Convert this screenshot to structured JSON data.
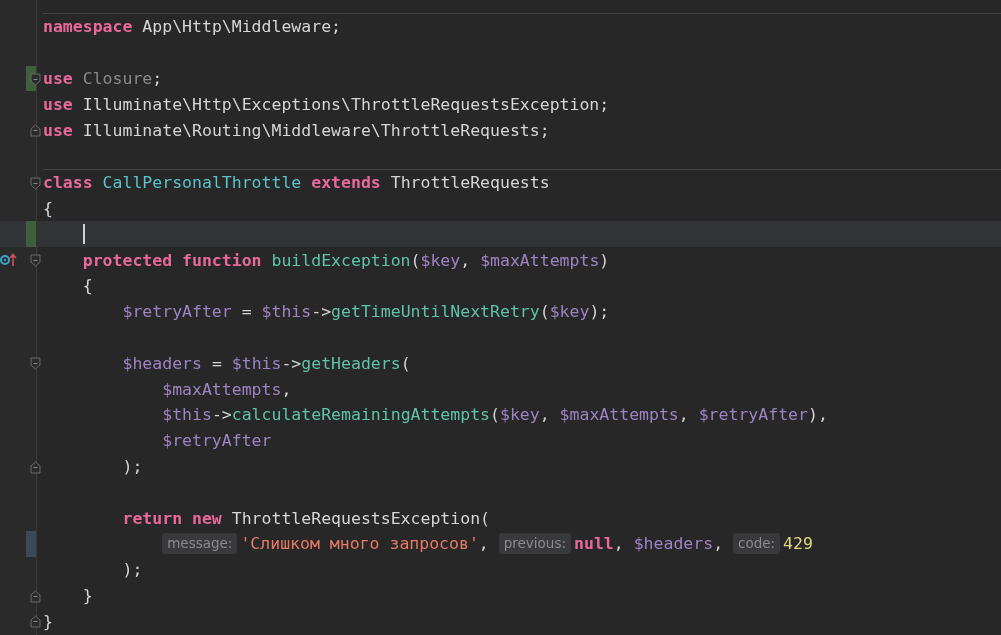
{
  "lines": [
    {
      "kind": "code",
      "separator_above": true,
      "tokens": [
        {
          "kind": "keyword",
          "text": "namespace"
        },
        {
          "kind": "plain",
          "text": " App\\Http\\Middleware;"
        }
      ]
    },
    {
      "kind": "blank"
    },
    {
      "kind": "code",
      "color": "#3f5e3c",
      "fold_start": true,
      "tokens": [
        {
          "kind": "keyword",
          "text": "use"
        },
        {
          "kind": "unused",
          "text": " Closure"
        },
        {
          "kind": "plain",
          "text": ";"
        }
      ]
    },
    {
      "kind": "code",
      "tokens": [
        {
          "kind": "keyword",
          "text": "use"
        },
        {
          "kind": "plain",
          "text": " Illuminate\\Http\\Exceptions\\ThrottleRequestsException;"
        }
      ]
    },
    {
      "kind": "code",
      "fold_end": true,
      "tokens": [
        {
          "kind": "keyword",
          "text": "use"
        },
        {
          "kind": "plain",
          "text": " Illuminate\\Routing\\Middleware\\ThrottleRequests;"
        }
      ]
    },
    {
      "kind": "blank"
    },
    {
      "kind": "code",
      "separator_above": true,
      "fold_start": true,
      "tokens": [
        {
          "kind": "keyword",
          "text": "class"
        },
        {
          "kind": "class",
          "text": " CallPersonalThrottle"
        },
        {
          "kind": "keyword",
          "text": " extends"
        },
        {
          "kind": "plain",
          "text": " ThrottleRequests"
        }
      ]
    },
    {
      "kind": "code",
      "tokens": [
        {
          "kind": "plain",
          "text": "{"
        }
      ],
      "children": [
        {
          "kind": "blank",
          "current": true,
          "color": "#3f5e3c"
        },
        {
          "kind": "code",
          "overridden": true,
          "fold_start": true,
          "tokens": [
            {
              "kind": "keyword",
              "text": "protected function"
            },
            {
              "kind": "method",
              "text": " buildException"
            },
            {
              "kind": "plain",
              "text": "("
            },
            {
              "kind": "variable",
              "text": "$key"
            },
            {
              "kind": "plain",
              "text": ", "
            },
            {
              "kind": "variable",
              "text": "$maxAttempts"
            },
            {
              "kind": "plain",
              "text": ")"
            }
          ]
        },
        {
          "kind": "code",
          "tokens": [
            {
              "kind": "plain",
              "text": "{"
            }
          ],
          "children": [
            {
              "kind": "code",
              "tokens": [
                {
                  "kind": "variable",
                  "text": "$retryAfter"
                },
                {
                  "kind": "plain",
                  "text": " = "
                },
                {
                  "kind": "variable",
                  "text": "$this"
                },
                {
                  "kind": "plain",
                  "text": "->"
                },
                {
                  "kind": "method",
                  "text": "getTimeUntilNextRetry"
                },
                {
                  "kind": "plain",
                  "text": "("
                },
                {
                  "kind": "variable",
                  "text": "$key"
                },
                {
                  "kind": "plain",
                  "text": ");"
                }
              ]
            },
            {
              "kind": "blank"
            },
            {
              "kind": "code",
              "fold_start": true,
              "tokens": [
                {
                  "kind": "variable",
                  "text": "$headers"
                },
                {
                  "kind": "plain",
                  "text": " = "
                },
                {
                  "kind": "variable",
                  "text": "$this"
                },
                {
                  "kind": "plain",
                  "text": "->"
                },
                {
                  "kind": "method",
                  "text": "getHeaders"
                },
                {
                  "kind": "plain",
                  "text": "("
                }
              ],
              "children": [
                {
                  "kind": "code",
                  "tokens": [
                    {
                      "kind": "variable",
                      "text": "$maxAttempts"
                    },
                    {
                      "kind": "plain",
                      "text": ","
                    }
                  ]
                },
                {
                  "kind": "code",
                  "tokens": [
                    {
                      "kind": "variable",
                      "text": "$this"
                    },
                    {
                      "kind": "plain",
                      "text": "->"
                    },
                    {
                      "kind": "method",
                      "text": "calculateRemainingAttempts"
                    },
                    {
                      "kind": "plain",
                      "text": "("
                    },
                    {
                      "kind": "variable",
                      "text": "$key"
                    },
                    {
                      "kind": "plain",
                      "text": ", "
                    },
                    {
                      "kind": "variable",
                      "text": "$maxAttempts"
                    },
                    {
                      "kind": "plain",
                      "text": ", "
                    },
                    {
                      "kind": "variable",
                      "text": "$retryAfter"
                    },
                    {
                      "kind": "plain",
                      "text": "),"
                    }
                  ]
                },
                {
                  "kind": "code",
                  "tokens": [
                    {
                      "kind": "variable",
                      "text": "$retryAfter"
                    }
                  ]
                }
              ]
            },
            {
              "kind": "code",
              "fold_end": true,
              "tokens": [
                {
                  "kind": "plain",
                  "text": ");"
                }
              ]
            },
            {
              "kind": "blank"
            },
            {
              "kind": "code",
              "tokens": [
                {
                  "kind": "keyword",
                  "text": "return new"
                },
                {
                  "kind": "plain",
                  "text": " ThrottleRequestsException("
                }
              ],
              "children": [
                {
                  "kind": "code",
                  "color": "#3b4a58",
                  "tokens": [
                    {
                      "kind": "hint",
                      "text": "message:"
                    },
                    {
                      "kind": "string",
                      "text": "'Слишком много запросов'"
                    },
                    {
                      "kind": "plain",
                      "text": ", "
                    },
                    {
                      "kind": "hint",
                      "text": "previous:"
                    },
                    {
                      "kind": "keyword",
                      "text": "null"
                    },
                    {
                      "kind": "plain",
                      "text": ", "
                    },
                    {
                      "kind": "variable",
                      "text": "$headers"
                    },
                    {
                      "kind": "plain",
                      "text": ", "
                    },
                    {
                      "kind": "hint",
                      "text": "code:"
                    },
                    {
                      "kind": "number",
                      "text": "429"
                    }
                  ]
                }
              ]
            },
            {
              "kind": "code",
              "tokens": [
                {
                  "kind": "plain",
                  "text": ");"
                }
              ]
            }
          ]
        },
        {
          "kind": "code",
          "fold_end": true,
          "tokens": [
            {
              "kind": "plain",
              "text": "}"
            }
          ]
        }
      ]
    },
    {
      "kind": "code",
      "fold_end": true,
      "tokens": [
        {
          "kind": "plain",
          "text": "}"
        }
      ]
    }
  ]
}
